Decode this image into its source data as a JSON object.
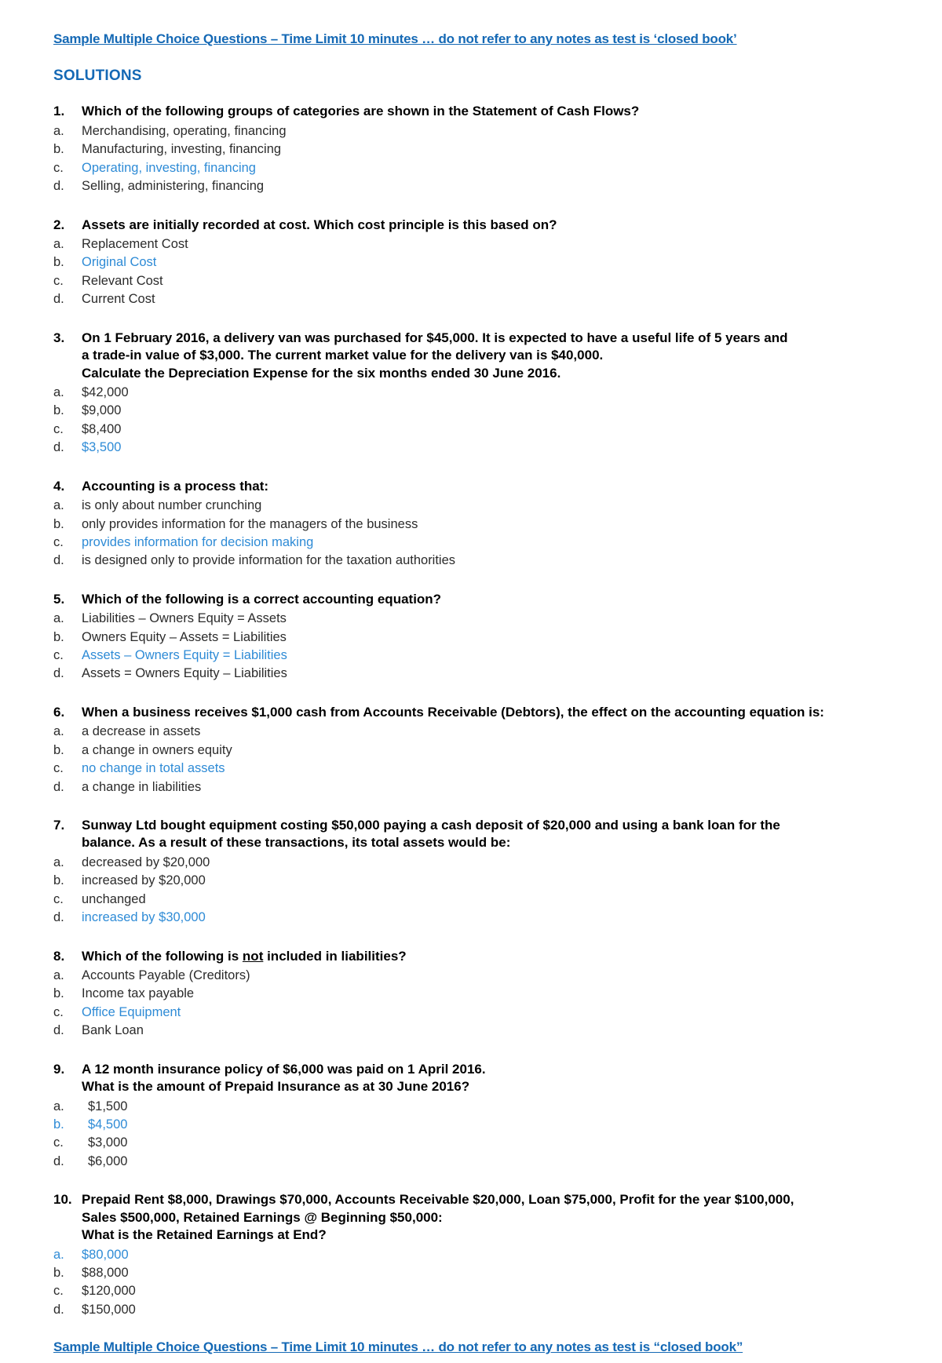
{
  "document": {
    "header_title": "Sample Multiple Choice Questions – Time Limit 10 minutes …  do not refer to any notes as test is ‘closed book’",
    "solutions_heading": "SOLUTIONS",
    "footer_title": "Sample Multiple Choice Questions – Time Limit 10 minutes …  do not refer to any notes as test is “closed book”",
    "accent_color": "#1569B5",
    "answer_color": "#2E8BD6",
    "body_color": "#000000"
  },
  "questions": [
    {
      "number": "1.",
      "stem_lines": [
        "Which of the following groups of categories are shown in the Statement of Cash Flows?"
      ],
      "options": [
        {
          "letter": "a.",
          "text": "Merchandising, operating, financing",
          "is_answer": false,
          "letter_highlighted": false
        },
        {
          "letter": "b.",
          "text": "Manufacturing, investing, financing",
          "is_answer": false,
          "letter_highlighted": false
        },
        {
          "letter": "c.",
          "text": "Operating, investing, financing",
          "is_answer": true,
          "letter_highlighted": false
        },
        {
          "letter": "d.",
          "text": "Selling, administering, financing",
          "is_answer": false,
          "letter_highlighted": false
        }
      ]
    },
    {
      "number": "2.",
      "stem_lines": [
        "Assets are initially recorded at cost.  Which cost principle is this based on?"
      ],
      "options": [
        {
          "letter": "a.",
          "text": "Replacement Cost",
          "is_answer": false,
          "letter_highlighted": false
        },
        {
          "letter": "b.",
          "text": "Original Cost",
          "is_answer": true,
          "letter_highlighted": false
        },
        {
          "letter": "c.",
          "text": "Relevant Cost",
          "is_answer": false,
          "letter_highlighted": false
        },
        {
          "letter": "d.",
          "text": "Current Cost",
          "is_answer": false,
          "letter_highlighted": false
        }
      ]
    },
    {
      "number": "3.",
      "stem_lines": [
        "On 1 February 2016, a delivery van was purchased for $45,000.  It is expected to have a useful life of 5 years and",
        "a trade-in value of $3,000.  The current market value for the delivery van is $40,000.",
        "Calculate the Depreciation Expense for the six months ended 30 June 2016."
      ],
      "options": [
        {
          "letter": "a.",
          "text": "$42,000",
          "is_answer": false,
          "letter_highlighted": false
        },
        {
          "letter": "b.",
          "text": "$9,000",
          "is_answer": false,
          "letter_highlighted": false
        },
        {
          "letter": "c.",
          "text": "$8,400",
          "is_answer": false,
          "letter_highlighted": false
        },
        {
          "letter": "d.",
          "text": "$3,500",
          "is_answer": true,
          "letter_highlighted": false
        }
      ]
    },
    {
      "number": "4.",
      "stem_lines": [
        "Accounting is a process that:"
      ],
      "options": [
        {
          "letter": "a.",
          "text": "is only about number crunching",
          "is_answer": false,
          "letter_highlighted": false
        },
        {
          "letter": "b.",
          "text": "only provides information for the managers of the business",
          "is_answer": false,
          "letter_highlighted": false
        },
        {
          "letter": "c.",
          "text": "provides information for decision making",
          "is_answer": true,
          "letter_highlighted": false
        },
        {
          "letter": "d.",
          "text": "is designed only to provide information for the taxation authorities",
          "is_answer": false,
          "letter_highlighted": false
        }
      ]
    },
    {
      "number": "5.",
      "stem_lines": [
        "Which of the following is a correct accounting equation?"
      ],
      "options": [
        {
          "letter": "a.",
          "text": "Liabilities – Owners Equity = Assets",
          "is_answer": false,
          "letter_highlighted": false
        },
        {
          "letter": "b.",
          "text": "Owners Equity – Assets = Liabilities",
          "is_answer": false,
          "letter_highlighted": false
        },
        {
          "letter": "c.",
          "text": "Assets – Owners Equity = Liabilities",
          "is_answer": true,
          "letter_highlighted": false
        },
        {
          "letter": "d.",
          "text": "Assets = Owners Equity – Liabilities",
          "is_answer": false,
          "letter_highlighted": false
        }
      ]
    },
    {
      "number": "6.",
      "stem_lines": [
        "When a business receives $1,000 cash from Accounts Receivable (Debtors), the effect on the accounting equation is:"
      ],
      "options": [
        {
          "letter": "a.",
          "text": "a decrease in assets",
          "is_answer": false,
          "letter_highlighted": false
        },
        {
          "letter": "b.",
          "text": "a change in owners equity",
          "is_answer": false,
          "letter_highlighted": false
        },
        {
          "letter": "c.",
          "text": "no change in total assets",
          "is_answer": true,
          "letter_highlighted": false
        },
        {
          "letter": "d.",
          "text": "a change in liabilities",
          "is_answer": false,
          "letter_highlighted": false
        }
      ]
    },
    {
      "number": "7.",
      "stem_lines": [
        "Sunway Ltd bought equipment costing $50,000 paying a cash deposit of $20,000 and using a bank loan for the",
        "balance.  As a result of these transactions, its total assets would be:"
      ],
      "options": [
        {
          "letter": "a.",
          "text": "decreased by $20,000",
          "is_answer": false,
          "letter_highlighted": false
        },
        {
          "letter": "b.",
          "text": "increased by $20,000",
          "is_answer": false,
          "letter_highlighted": false
        },
        {
          "letter": "c.",
          "text": "unchanged",
          "is_answer": false,
          "letter_highlighted": false
        },
        {
          "letter": "d.",
          "text": "increased by $30,000",
          "is_answer": true,
          "letter_highlighted": false
        }
      ]
    },
    {
      "number": "8.",
      "stem_html": true,
      "stem_prefix": "Which of the following is ",
      "stem_underlined": "not",
      "stem_suffix": " included in liabilities?",
      "stem_lines": [
        "Which of the following is not included in liabilities?"
      ],
      "options": [
        {
          "letter": "a.",
          "text": "Accounts Payable (Creditors)",
          "is_answer": false,
          "letter_highlighted": false
        },
        {
          "letter": "b.",
          "text": "Income tax payable",
          "is_answer": false,
          "letter_highlighted": false
        },
        {
          "letter": "c.",
          "text": "Office Equipment",
          "is_answer": true,
          "letter_highlighted": false
        },
        {
          "letter": "d.",
          "text": "Bank Loan",
          "is_answer": false,
          "letter_highlighted": false
        }
      ]
    },
    {
      "number": "9.",
      "extra_indent": true,
      "stem_lines": [
        "A 12 month insurance policy of $6,000 was paid on 1 April 2016.",
        "What is the amount of Prepaid Insurance as at 30 June 2016?"
      ],
      "options": [
        {
          "letter": "a.",
          "text": "$1,500",
          "is_answer": false,
          "letter_highlighted": false
        },
        {
          "letter": "b.",
          "text": "$4,500",
          "is_answer": true,
          "letter_highlighted": true
        },
        {
          "letter": "c.",
          "text": "$3,000",
          "is_answer": false,
          "letter_highlighted": false
        },
        {
          "letter": "d.",
          "text": "$6,000",
          "is_answer": false,
          "letter_highlighted": false
        }
      ]
    },
    {
      "number": "10.",
      "stem_lines": [
        "Prepaid Rent $8,000, Drawings $70,000, Accounts Receivable $20,000, Loan $75,000, Profit for the year $100,000,",
        "Sales $500,000, Retained Earnings @ Beginning $50,000:",
        "What is the Retained Earnings at End?"
      ],
      "options": [
        {
          "letter": "a.",
          "text": "$80,000",
          "is_answer": true,
          "letter_highlighted": true
        },
        {
          "letter": "b.",
          "text": "$88,000",
          "is_answer": false,
          "letter_highlighted": false
        },
        {
          "letter": "c.",
          "text": "$120,000",
          "is_answer": false,
          "letter_highlighted": false
        },
        {
          "letter": "d.",
          "text": "$150,000",
          "is_answer": false,
          "letter_highlighted": false
        }
      ]
    }
  ]
}
